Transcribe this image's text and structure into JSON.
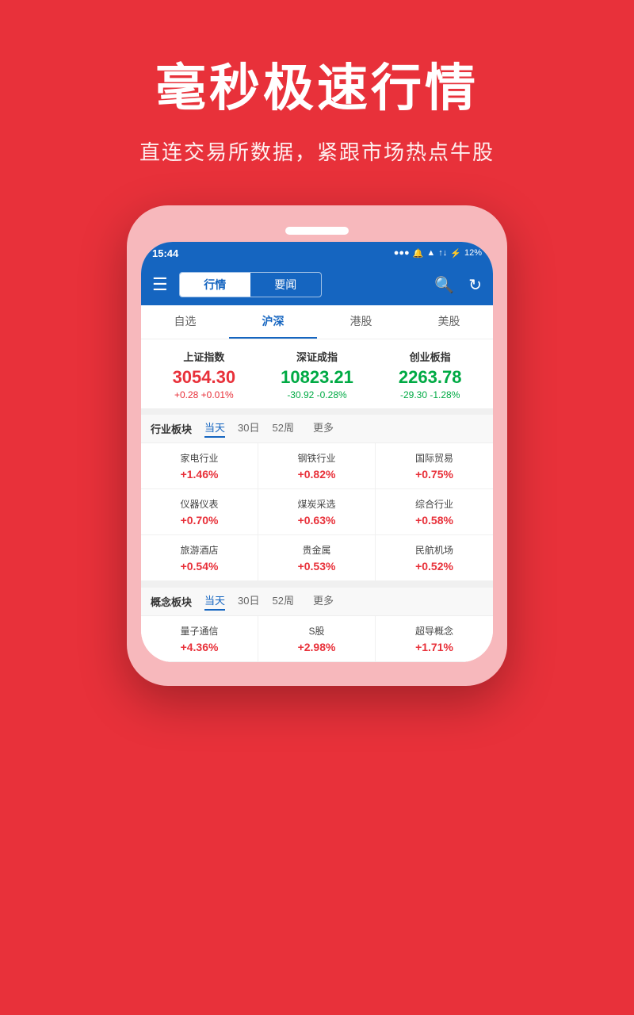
{
  "hero": {
    "title": "毫秒极速行情",
    "subtitle": "直连交易所数据，紧跟市场热点牛股"
  },
  "status_bar": {
    "time": "15:44",
    "battery": "12%"
  },
  "nav": {
    "tab1": "行情",
    "tab2": "要闻",
    "active": "tab1"
  },
  "market_tabs": [
    {
      "label": "自选",
      "active": false
    },
    {
      "label": "沪深",
      "active": true
    },
    {
      "label": "港股",
      "active": false
    },
    {
      "label": "美股",
      "active": false
    }
  ],
  "indices": [
    {
      "name": "上证指数",
      "value": "3054.30",
      "change": "+0.28  +0.01%",
      "color": "red"
    },
    {
      "name": "深证成指",
      "value": "10823.21",
      "change": "-30.92  -0.28%",
      "color": "green"
    },
    {
      "name": "创业板指",
      "value": "2263.78",
      "change": "-29.30  -1.28%",
      "color": "green"
    }
  ],
  "sector_section": {
    "title": "行业板块",
    "tabs": [
      "当天",
      "30日",
      "52周",
      "更多"
    ],
    "active_tab": "当天",
    "items": [
      {
        "name": "家电行业",
        "change": "+1.46%"
      },
      {
        "name": "钢铁行业",
        "change": "+0.82%"
      },
      {
        "name": "国际贸易",
        "change": "+0.75%"
      },
      {
        "name": "仪器仪表",
        "change": "+0.70%"
      },
      {
        "name": "煤炭采选",
        "change": "+0.63%"
      },
      {
        "name": "综合行业",
        "change": "+0.58%"
      },
      {
        "name": "旅游酒店",
        "change": "+0.54%"
      },
      {
        "name": "贵金属",
        "change": "+0.53%"
      },
      {
        "name": "民航机场",
        "change": "+0.52%"
      }
    ]
  },
  "concept_section": {
    "title": "概念板块",
    "tabs": [
      "当天",
      "30日",
      "52周",
      "更多"
    ],
    "active_tab": "当天",
    "items": [
      {
        "name": "量子通信",
        "change": "+4.36%"
      },
      {
        "name": "S股",
        "change": "+2.98%"
      },
      {
        "name": "超导概念",
        "change": "+1.71%"
      }
    ]
  }
}
